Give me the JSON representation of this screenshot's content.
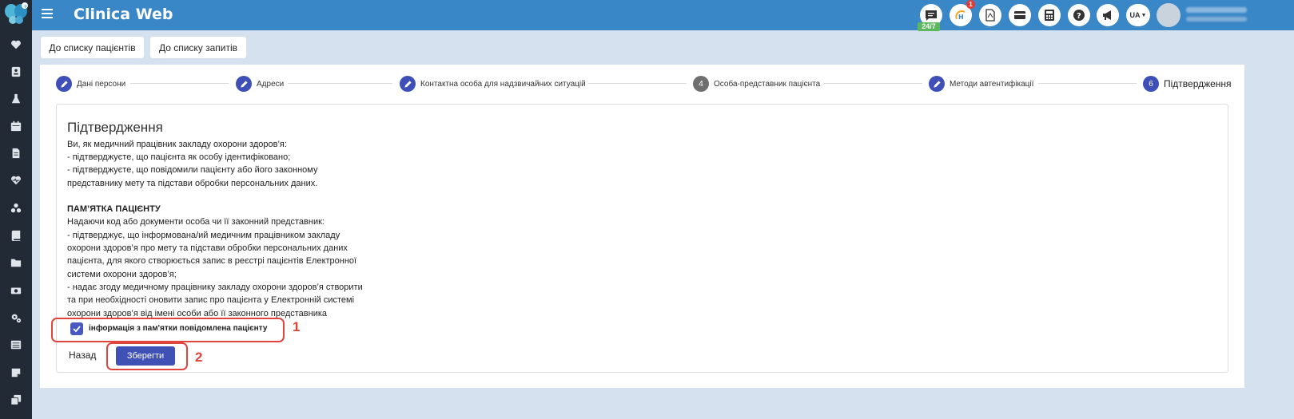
{
  "header": {
    "title": "Clinica Web",
    "support_badge": "24/7",
    "notification_count": "1",
    "language": "UA"
  },
  "colors": {
    "header_bg": "#3a87c8",
    "sidebar_bg": "#222a35",
    "accent": "#3f51b5",
    "annotation": "#e0443c"
  },
  "sidebar": {
    "icons": [
      "logo-icon",
      "heart-icon",
      "id-card-icon",
      "flask-icon",
      "calendar-icon",
      "document-icon",
      "heartbeat-icon",
      "people-icon",
      "book-icon",
      "folder-icon",
      "money-icon",
      "gears-icon",
      "list-icon",
      "note-icon",
      "copy-icon"
    ]
  },
  "nav": {
    "patients_list": "До списку пацієнтів",
    "requests_list": "До списку запитів"
  },
  "stepper": {
    "steps": [
      {
        "label": "Дані персони",
        "state": "done"
      },
      {
        "label": "Адреси",
        "state": "done"
      },
      {
        "label": "Контактна особа для надзвичайних ситуацій",
        "state": "done"
      },
      {
        "label": "Особа-представник пацієнта",
        "state": "pending",
        "number": "4"
      },
      {
        "label": "Методи автентифікації",
        "state": "done"
      },
      {
        "label": "Підтвердження",
        "state": "active",
        "number": "6"
      }
    ]
  },
  "content": {
    "title": "Підтвердження",
    "intro_lines": [
      "Ви, як медичний працівник закладу охорони здоров’я:",
      "- підтверджуєте, що пацієнта як особу ідентифіковано;",
      "- підтверджуєте, що повідомили пацієнту або його законному",
      "представнику мету та підстави обробки персональних даних."
    ],
    "memo_title": "ПАМ’ЯТКА ПАЦІЄНТУ",
    "memo_lines": [
      "Надаючи код або документи особа чи її законний представник:",
      "- підтверджує, що інформована/ий медичним працівником закладу",
      "охорони здоров’я про мету та підстави обробки персональних даних",
      "пацієнта, для якого створюється запис в реєстрі пацієнтів Електронної",
      "системи охорони здоров’я;",
      "- надає згоду медичному працівнику закладу охорони здоров’я створити",
      "та при необхідності оновити запис про пацієнта у Електронній системі",
      "охорони здоров’я від імені особи або її законного представника"
    ],
    "checkbox_label": "інформація з пам'ятки повідомлена пацієнту",
    "checkbox_checked": true,
    "back_label": "Назад",
    "save_label": "Зберегти"
  },
  "annotations": {
    "first": "1",
    "second": "2"
  }
}
